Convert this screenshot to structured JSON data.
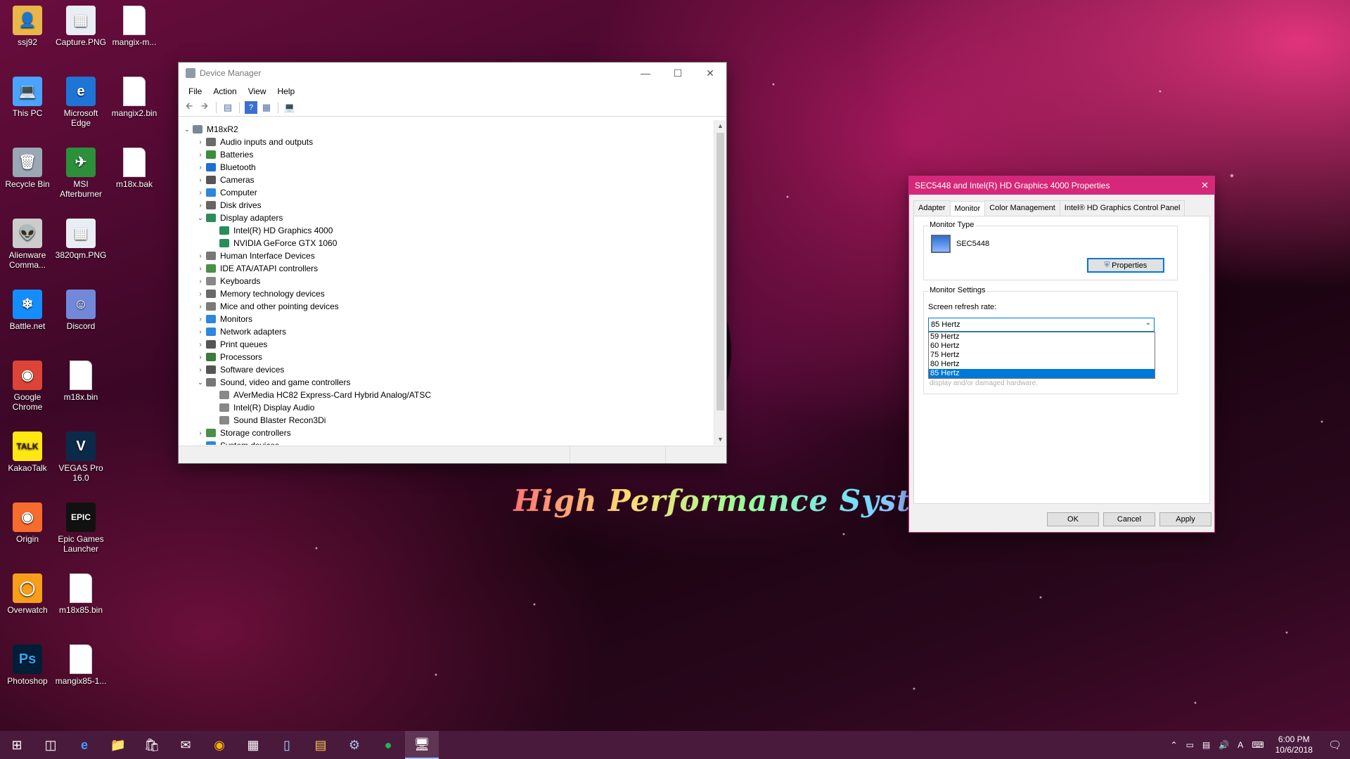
{
  "desktop": {
    "icons": [
      {
        "label": "ssj92",
        "col": 0,
        "row": 0,
        "kind": "user-folder"
      },
      {
        "label": "This PC",
        "col": 0,
        "row": 1,
        "kind": "computer"
      },
      {
        "label": "Recycle Bin",
        "col": 0,
        "row": 2,
        "kind": "recycle-bin"
      },
      {
        "label": "Alienware Comma...",
        "col": 0,
        "row": 3,
        "kind": "alienware"
      },
      {
        "label": "Battle.net",
        "col": 0,
        "row": 4,
        "kind": "battlenet"
      },
      {
        "label": "Google Chrome",
        "col": 0,
        "row": 5,
        "kind": "chrome"
      },
      {
        "label": "KakaoTalk",
        "col": 0,
        "row": 6,
        "kind": "kakaotalk"
      },
      {
        "label": "Origin",
        "col": 0,
        "row": 7,
        "kind": "origin"
      },
      {
        "label": "Overwatch",
        "col": 0,
        "row": 8,
        "kind": "overwatch"
      },
      {
        "label": "Photoshop",
        "col": 0,
        "row": 9,
        "kind": "photoshop"
      },
      {
        "label": "Capture.PNG",
        "col": 1,
        "row": 0,
        "kind": "image"
      },
      {
        "label": "Microsoft Edge",
        "col": 1,
        "row": 1,
        "kind": "edge"
      },
      {
        "label": "MSI Afterburner",
        "col": 1,
        "row": 2,
        "kind": "afterburner"
      },
      {
        "label": "3820qm.PNG",
        "col": 1,
        "row": 3,
        "kind": "image"
      },
      {
        "label": "Discord",
        "col": 1,
        "row": 4,
        "kind": "discord"
      },
      {
        "label": "m18x.bin",
        "col": 1,
        "row": 5,
        "kind": "file"
      },
      {
        "label": "VEGAS Pro 16.0",
        "col": 1,
        "row": 6,
        "kind": "vegas"
      },
      {
        "label": "Epic Games Launcher",
        "col": 1,
        "row": 7,
        "kind": "epic"
      },
      {
        "label": "m18x85.bin",
        "col": 1,
        "row": 8,
        "kind": "file"
      },
      {
        "label": "mangix85-1...",
        "col": 1,
        "row": 9,
        "kind": "file"
      },
      {
        "label": "mangix-m...",
        "col": 2,
        "row": 0,
        "kind": "file"
      },
      {
        "label": "mangix2.bin",
        "col": 2,
        "row": 1,
        "kind": "file"
      },
      {
        "label": "m18x.bak",
        "col": 2,
        "row": 2,
        "kind": "file"
      }
    ],
    "wallpaper_text": "High Performance Systems"
  },
  "device_manager": {
    "title": "Device Manager",
    "menu": [
      "File",
      "Action",
      "View",
      "Help"
    ],
    "toolbar": [
      "back-arrow-icon",
      "forward-arrow-icon",
      "show-hide-icon",
      "help-icon",
      "properties-icon",
      "monitor-icon"
    ],
    "tree": [
      {
        "label": "M18xR2",
        "level": 0,
        "expanded": true,
        "icon": "#7a8796"
      },
      {
        "label": "Audio inputs and outputs",
        "level": 1,
        "expanded": false,
        "icon": "#6b6b6b"
      },
      {
        "label": "Batteries",
        "level": 1,
        "expanded": false,
        "icon": "#3b8f3b"
      },
      {
        "label": "Bluetooth",
        "level": 1,
        "expanded": false,
        "icon": "#1f6fd1"
      },
      {
        "label": "Cameras",
        "level": 1,
        "expanded": false,
        "icon": "#555555"
      },
      {
        "label": "Computer",
        "level": 1,
        "expanded": false,
        "icon": "#2e86de"
      },
      {
        "label": "Disk drives",
        "level": 1,
        "expanded": false,
        "icon": "#666666"
      },
      {
        "label": "Display adapters",
        "level": 1,
        "expanded": true,
        "icon": "#2a8d5a"
      },
      {
        "label": "Intel(R) HD Graphics 4000",
        "level": 2,
        "expanded": null,
        "icon": "#2a8d5a"
      },
      {
        "label": "NVIDIA GeForce GTX 1060",
        "level": 2,
        "expanded": null,
        "icon": "#2a8d5a"
      },
      {
        "label": "Human Interface Devices",
        "level": 1,
        "expanded": false,
        "icon": "#777777"
      },
      {
        "label": "IDE ATA/ATAPI controllers",
        "level": 1,
        "expanded": false,
        "icon": "#4a8f4a"
      },
      {
        "label": "Keyboards",
        "level": 1,
        "expanded": false,
        "icon": "#888888"
      },
      {
        "label": "Memory technology devices",
        "level": 1,
        "expanded": false,
        "icon": "#6a6a6a"
      },
      {
        "label": "Mice and other pointing devices",
        "level": 1,
        "expanded": false,
        "icon": "#7a7a7a"
      },
      {
        "label": "Monitors",
        "level": 1,
        "expanded": false,
        "icon": "#2e86de"
      },
      {
        "label": "Network adapters",
        "level": 1,
        "expanded": false,
        "icon": "#2e86de"
      },
      {
        "label": "Print queues",
        "level": 1,
        "expanded": false,
        "icon": "#555555"
      },
      {
        "label": "Processors",
        "level": 1,
        "expanded": false,
        "icon": "#3a7a3a"
      },
      {
        "label": "Software devices",
        "level": 1,
        "expanded": false,
        "icon": "#555555"
      },
      {
        "label": "Sound, video and game controllers",
        "level": 1,
        "expanded": true,
        "icon": "#777777"
      },
      {
        "label": "AVerMedia HC82 Express-Card Hybrid Analog/ATSC",
        "level": 2,
        "expanded": null,
        "icon": "#888888"
      },
      {
        "label": "Intel(R) Display Audio",
        "level": 2,
        "expanded": null,
        "icon": "#888888"
      },
      {
        "label": "Sound Blaster Recon3Di",
        "level": 2,
        "expanded": null,
        "icon": "#888888"
      },
      {
        "label": "Storage controllers",
        "level": 1,
        "expanded": false,
        "icon": "#4a8f4a"
      },
      {
        "label": "System devices",
        "level": 1,
        "expanded": false,
        "icon": "#2e86de"
      }
    ]
  },
  "properties": {
    "title": "SEC5448 and Intel(R) HD Graphics 4000 Properties",
    "tabs": [
      "Adapter",
      "Monitor",
      "Color Management",
      "Intel® HD Graphics Control Panel"
    ],
    "active_tab": "Monitor",
    "monitor_type_label": "Monitor Type",
    "monitor_name": "SEC5448",
    "properties_button": "Properties",
    "monitor_settings_label": "Monitor Settings",
    "refresh_label": "Screen refresh rate:",
    "refresh_value": "85 Hertz",
    "refresh_options": [
      "59 Hertz",
      "60 Hertz",
      "75 Hertz",
      "80 Hertz",
      "85 Hertz"
    ],
    "hidden_hint": "display and/or damaged hardware.",
    "ok": "OK",
    "cancel": "Cancel",
    "apply": "Apply",
    "accent": "#d6287a"
  },
  "taskbar": {
    "items": [
      "start-icon",
      "task-view-icon",
      "edge-icon",
      "file-explorer-icon",
      "store-icon",
      "mail-icon",
      "chrome-icon",
      "calculator-icon",
      "notepad-icon",
      "folder-icon",
      "steam-icon",
      "spotify-icon",
      "device-manager-icon"
    ],
    "active": "device-manager-icon",
    "tray": [
      "chevron-up-icon",
      "battery-icon",
      "network-icon",
      "volume-icon",
      "ime-icon",
      "keyboard-icon"
    ],
    "ime_label": "A",
    "time": "6:00 PM",
    "date": "10/6/2018"
  }
}
